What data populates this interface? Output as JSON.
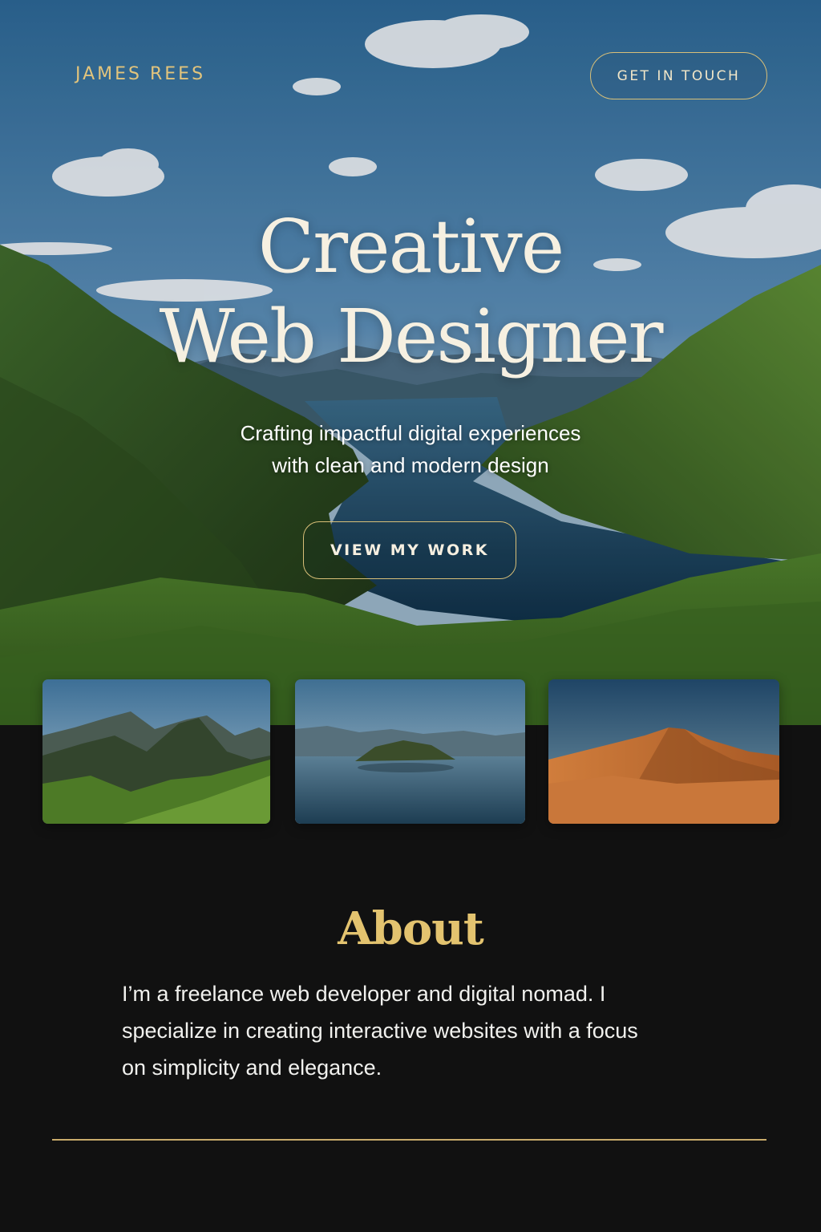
{
  "nav": {
    "brand": "JAMES REES",
    "contact_label": "GET IN TOUCH"
  },
  "hero": {
    "title_line1": "Creative",
    "title_line2": "Web Designer",
    "subtitle_line1": "Crafting impactful digital experiences",
    "subtitle_line2": "with clean and modern design",
    "cta_label": "VIEW MY WORK"
  },
  "gallery": {
    "items": [
      {
        "subject": "mountain-range"
      },
      {
        "subject": "lake-island"
      },
      {
        "subject": "desert-dune"
      }
    ]
  },
  "about": {
    "heading": "About",
    "body_line1": "I’m a freelance web developer and digital nomad. I",
    "body_line2": "specialize in creating interactive websites with a focus",
    "body_line3": "on simplicity and elegance."
  },
  "colors": {
    "accent_gold": "#e3c36f",
    "background_dark": "#111111",
    "text_cream": "#f6f0e1"
  },
  "icons": {
    "hero_background": "landscape-image",
    "thumbnail_1": "mountain-image",
    "thumbnail_2": "lake-image",
    "thumbnail_3": "desert-image"
  }
}
